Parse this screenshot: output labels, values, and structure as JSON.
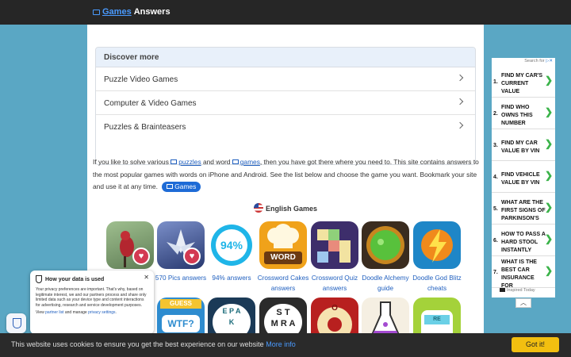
{
  "header": {
    "link": "Games",
    "title": "Answers"
  },
  "discover": {
    "heading": "Discover more",
    "items": [
      "Puzzle Video Games",
      "Computer & Video Games",
      "Puzzles & Brainteasers"
    ]
  },
  "intro": {
    "t1": "If you like to solve various",
    "puzzles": "puzzles",
    "t2": "and word",
    "games": "games",
    "t3": ", then you have got there where you need to. This site contains answers to the most popular games with words on iPhone and Android. See the list below and choose the game you want. Bookmark your site and use it at any time.",
    "button": "Games"
  },
  "section": {
    "title": "English Games"
  },
  "games": [
    {
      "label": "570 Pics answers"
    },
    {
      "label": "94% answers"
    },
    {
      "label": "Crossword Cakes answers"
    },
    {
      "label": "Crossword Quiz answers"
    },
    {
      "label": "Doodle Alchemy guide"
    },
    {
      "label": "Doodle God Blitz cheats"
    }
  ],
  "tiles": {
    "word": "WORD",
    "percent": "94%",
    "wtf": "WTF?",
    "guess": "GUESS",
    "re": "RE",
    "letters": [
      "S",
      "M",
      "A",
      "R",
      "T",
      "E",
      "P",
      "K",
      "O",
      "A"
    ]
  },
  "ad": {
    "top": "Search for",
    "items": [
      {
        "num": "1.",
        "text": "FIND MY CAR'S CURRENT VALUE"
      },
      {
        "num": "2.",
        "text": "FIND WHO OWNS THIS NUMBER"
      },
      {
        "num": "3.",
        "text": "FIND MY CAR VALUE BY VIN"
      },
      {
        "num": "4.",
        "text": "FIND VEHICLE VALUE BY VIN"
      },
      {
        "num": "5.",
        "text": "WHAT ARE THE FIRST SIGNS OF PARKINSON'S"
      },
      {
        "num": "6.",
        "text": "HOW TO PASS A HARD STOOL INSTANTLY"
      },
      {
        "num": "7.",
        "text": "WHAT IS THE BEST CAR INSURANCE FOR"
      }
    ],
    "footer": "Inspired Today"
  },
  "privacy": {
    "title": "How your data is used",
    "body": "Your privacy preferences are important. That's why, based on legitimate interest, we and our partners process and share only limited data such as your device type and content interactions for advertising, research and service development purposes.",
    "foot1": "View",
    "partner": "partner list",
    "foot2": "and manage",
    "settings": "privacy settings",
    "foot3": "."
  },
  "cookie": {
    "text": "This website uses cookies to ensure you get the best experience on our website",
    "more": "More info",
    "button": "Got it!"
  }
}
